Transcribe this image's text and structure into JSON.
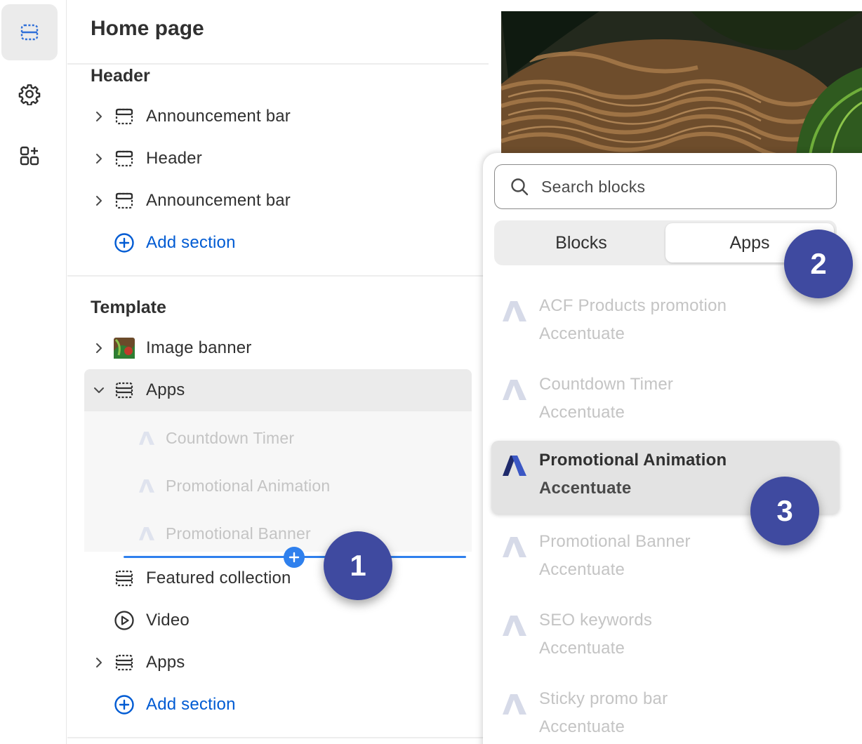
{
  "sidebar": {
    "page_title": "Home page",
    "header_group": {
      "title": "Header",
      "items": [
        {
          "label": "Announcement bar",
          "icon": "section-icon"
        },
        {
          "label": "Header",
          "icon": "section-icon"
        },
        {
          "label": "Announcement bar",
          "icon": "section-icon"
        }
      ],
      "add_label": "Add section"
    },
    "template_group": {
      "title": "Template",
      "items": [
        {
          "label": "Image banner",
          "icon": "image-thumbnail"
        },
        {
          "label": "Apps",
          "icon": "apps-section-icon",
          "expanded": true,
          "blocks": [
            {
              "label": "Countdown Timer"
            },
            {
              "label": "Promotional Animation"
            },
            {
              "label": "Promotional Banner"
            }
          ]
        },
        {
          "label": "Featured collection",
          "icon": "section-icon"
        },
        {
          "label": "Video",
          "icon": "play-circle-icon"
        },
        {
          "label": "Apps",
          "icon": "apps-section-icon"
        }
      ],
      "add_label": "Add section"
    }
  },
  "popover": {
    "search_placeholder": "Search blocks",
    "tabs": [
      {
        "label": "Blocks"
      },
      {
        "label": "Apps",
        "active": true
      }
    ],
    "apps": [
      {
        "name": "ACF Products promotion",
        "vendor": "Accentuate"
      },
      {
        "name": "Countdown Timer",
        "vendor": "Accentuate"
      },
      {
        "name": "Promotional Animation",
        "vendor": "Accentuate",
        "highlighted": true
      },
      {
        "name": "Promotional Banner",
        "vendor": "Accentuate"
      },
      {
        "name": "SEO keywords",
        "vendor": "Accentuate"
      },
      {
        "name": "Sticky promo bar",
        "vendor": "Accentuate"
      }
    ]
  },
  "badges": [
    "1",
    "2",
    "3"
  ],
  "colors": {
    "accent_blue": "#005bd3",
    "insert_line": "#2f80ed",
    "badge": "#3f4aa0",
    "selected_row": "#ebebeb"
  }
}
